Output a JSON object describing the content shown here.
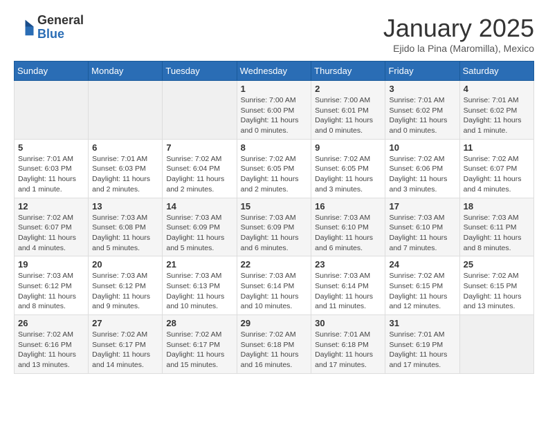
{
  "header": {
    "logo_general": "General",
    "logo_blue": "Blue",
    "calendar_title": "January 2025",
    "calendar_subtitle": "Ejido la Pina (Maromilla), Mexico"
  },
  "weekdays": [
    "Sunday",
    "Monday",
    "Tuesday",
    "Wednesday",
    "Thursday",
    "Friday",
    "Saturday"
  ],
  "weeks": [
    [
      {
        "day": "",
        "info": ""
      },
      {
        "day": "",
        "info": ""
      },
      {
        "day": "",
        "info": ""
      },
      {
        "day": "1",
        "info": "Sunrise: 7:00 AM\nSunset: 6:00 PM\nDaylight: 11 hours\nand 0 minutes."
      },
      {
        "day": "2",
        "info": "Sunrise: 7:00 AM\nSunset: 6:01 PM\nDaylight: 11 hours\nand 0 minutes."
      },
      {
        "day": "3",
        "info": "Sunrise: 7:01 AM\nSunset: 6:02 PM\nDaylight: 11 hours\nand 0 minutes."
      },
      {
        "day": "4",
        "info": "Sunrise: 7:01 AM\nSunset: 6:02 PM\nDaylight: 11 hours\nand 1 minute."
      }
    ],
    [
      {
        "day": "5",
        "info": "Sunrise: 7:01 AM\nSunset: 6:03 PM\nDaylight: 11 hours\nand 1 minute."
      },
      {
        "day": "6",
        "info": "Sunrise: 7:01 AM\nSunset: 6:03 PM\nDaylight: 11 hours\nand 2 minutes."
      },
      {
        "day": "7",
        "info": "Sunrise: 7:02 AM\nSunset: 6:04 PM\nDaylight: 11 hours\nand 2 minutes."
      },
      {
        "day": "8",
        "info": "Sunrise: 7:02 AM\nSunset: 6:05 PM\nDaylight: 11 hours\nand 2 minutes."
      },
      {
        "day": "9",
        "info": "Sunrise: 7:02 AM\nSunset: 6:05 PM\nDaylight: 11 hours\nand 3 minutes."
      },
      {
        "day": "10",
        "info": "Sunrise: 7:02 AM\nSunset: 6:06 PM\nDaylight: 11 hours\nand 3 minutes."
      },
      {
        "day": "11",
        "info": "Sunrise: 7:02 AM\nSunset: 6:07 PM\nDaylight: 11 hours\nand 4 minutes."
      }
    ],
    [
      {
        "day": "12",
        "info": "Sunrise: 7:02 AM\nSunset: 6:07 PM\nDaylight: 11 hours\nand 4 minutes."
      },
      {
        "day": "13",
        "info": "Sunrise: 7:03 AM\nSunset: 6:08 PM\nDaylight: 11 hours\nand 5 minutes."
      },
      {
        "day": "14",
        "info": "Sunrise: 7:03 AM\nSunset: 6:09 PM\nDaylight: 11 hours\nand 5 minutes."
      },
      {
        "day": "15",
        "info": "Sunrise: 7:03 AM\nSunset: 6:09 PM\nDaylight: 11 hours\nand 6 minutes."
      },
      {
        "day": "16",
        "info": "Sunrise: 7:03 AM\nSunset: 6:10 PM\nDaylight: 11 hours\nand 6 minutes."
      },
      {
        "day": "17",
        "info": "Sunrise: 7:03 AM\nSunset: 6:10 PM\nDaylight: 11 hours\nand 7 minutes."
      },
      {
        "day": "18",
        "info": "Sunrise: 7:03 AM\nSunset: 6:11 PM\nDaylight: 11 hours\nand 8 minutes."
      }
    ],
    [
      {
        "day": "19",
        "info": "Sunrise: 7:03 AM\nSunset: 6:12 PM\nDaylight: 11 hours\nand 8 minutes."
      },
      {
        "day": "20",
        "info": "Sunrise: 7:03 AM\nSunset: 6:12 PM\nDaylight: 11 hours\nand 9 minutes."
      },
      {
        "day": "21",
        "info": "Sunrise: 7:03 AM\nSunset: 6:13 PM\nDaylight: 11 hours\nand 10 minutes."
      },
      {
        "day": "22",
        "info": "Sunrise: 7:03 AM\nSunset: 6:14 PM\nDaylight: 11 hours\nand 10 minutes."
      },
      {
        "day": "23",
        "info": "Sunrise: 7:03 AM\nSunset: 6:14 PM\nDaylight: 11 hours\nand 11 minutes."
      },
      {
        "day": "24",
        "info": "Sunrise: 7:02 AM\nSunset: 6:15 PM\nDaylight: 11 hours\nand 12 minutes."
      },
      {
        "day": "25",
        "info": "Sunrise: 7:02 AM\nSunset: 6:15 PM\nDaylight: 11 hours\nand 13 minutes."
      }
    ],
    [
      {
        "day": "26",
        "info": "Sunrise: 7:02 AM\nSunset: 6:16 PM\nDaylight: 11 hours\nand 13 minutes."
      },
      {
        "day": "27",
        "info": "Sunrise: 7:02 AM\nSunset: 6:17 PM\nDaylight: 11 hours\nand 14 minutes."
      },
      {
        "day": "28",
        "info": "Sunrise: 7:02 AM\nSunset: 6:17 PM\nDaylight: 11 hours\nand 15 minutes."
      },
      {
        "day": "29",
        "info": "Sunrise: 7:02 AM\nSunset: 6:18 PM\nDaylight: 11 hours\nand 16 minutes."
      },
      {
        "day": "30",
        "info": "Sunrise: 7:01 AM\nSunset: 6:18 PM\nDaylight: 11 hours\nand 17 minutes."
      },
      {
        "day": "31",
        "info": "Sunrise: 7:01 AM\nSunset: 6:19 PM\nDaylight: 11 hours\nand 17 minutes."
      },
      {
        "day": "",
        "info": ""
      }
    ]
  ]
}
